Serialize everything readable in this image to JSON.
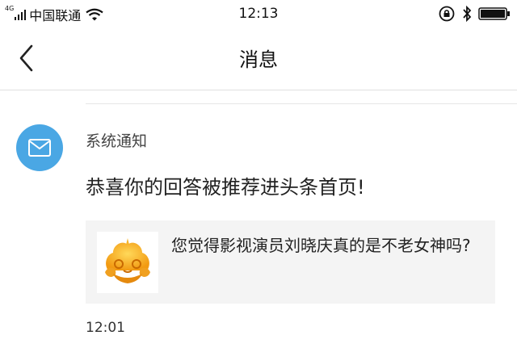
{
  "status_bar": {
    "network_type": "4G",
    "carrier": "中国联通",
    "time": "12:13"
  },
  "nav": {
    "title": "消息",
    "back_icon": "chevron-left-icon"
  },
  "message": {
    "sender": "系统通知",
    "avatar_icon": "envelope-icon",
    "avatar_color": "#4aa7e4",
    "text": "恭喜你的回答被推荐进头条首页!",
    "card": {
      "thumbnail_icon": "golden-cloud-logo",
      "question": "您觉得影视演员刘晓庆真的是不老女神吗?"
    },
    "time": "12:01"
  }
}
